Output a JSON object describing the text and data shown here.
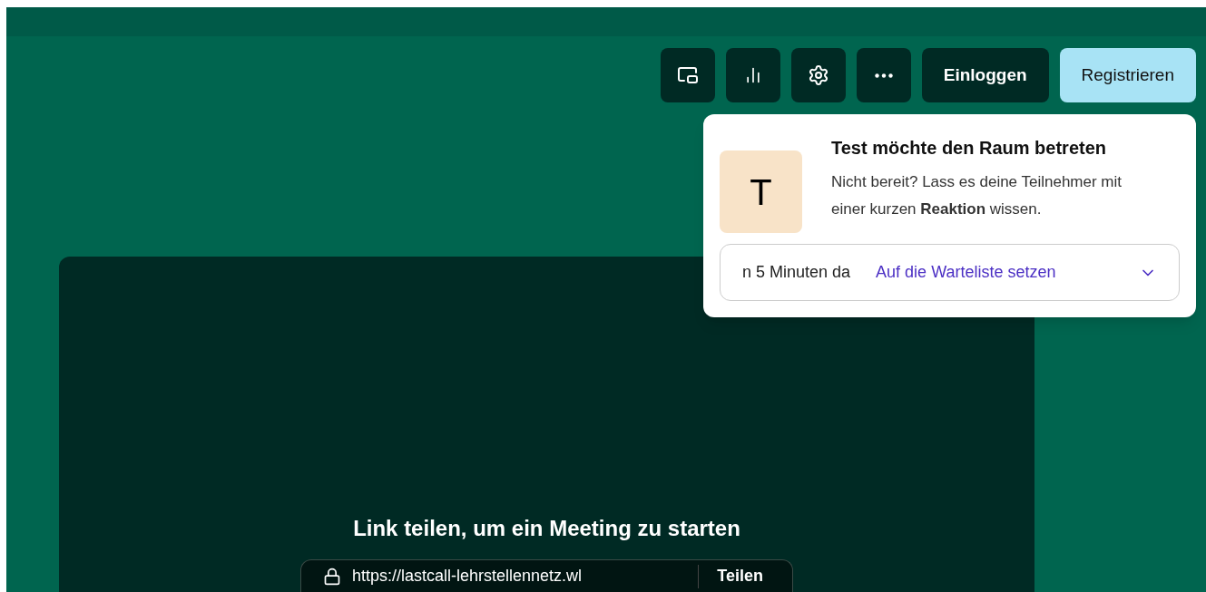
{
  "toolbar": {
    "icon_buttons": [
      {
        "kind": "pip"
      },
      {
        "kind": "stats"
      },
      {
        "kind": "settings"
      },
      {
        "kind": "more"
      }
    ],
    "login": "Einloggen",
    "register": "Registrieren"
  },
  "notification": {
    "avatar": "T",
    "title": "Test möchte den Raum betreten",
    "message": "Nicht bereit? Lass es deine Teilnehmer mit einer kurzen **Reaktion** wissen.",
    "reply": "n 5 Minuten da",
    "action": "Auf die Warteliste setzen"
  },
  "stage": {
    "heading": "Link teilen, um ein Meeting zu starten",
    "link": "https://lastcall-lehrstellennetz.wl",
    "share": "Teilen"
  }
}
